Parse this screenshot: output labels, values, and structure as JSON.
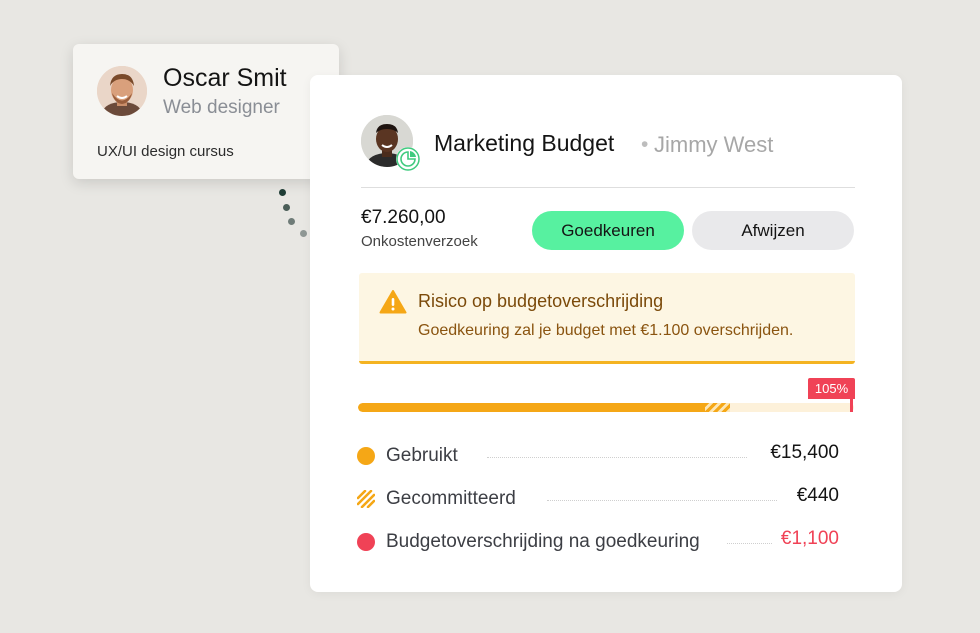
{
  "profile": {
    "name": "Oscar Smit",
    "role": "Web designer",
    "course": "UX/UI design cursus",
    "avatar_icon": "person-avatar"
  },
  "request": {
    "title": "Marketing Budget",
    "separator": "•",
    "owner": "Jimmy West",
    "avatar_icon": "person-avatar",
    "badge_icon": "pie-chart-icon",
    "amount": "€7.260,00",
    "amount_label": "Onkostenverzoek"
  },
  "actions": {
    "approve_label": "Goedkeuren",
    "reject_label": "Afwijzen"
  },
  "alert": {
    "icon": "warning-icon",
    "title": "Risico op budgetoverschrijding",
    "message": "Goedkeuring zal je budget met €1.100 overschrijden."
  },
  "progress": {
    "percent_label": "105%",
    "used_fraction": 0.7,
    "committed_fraction": 0.05
  },
  "legend": [
    {
      "label": "Gebruikt",
      "value": "€15,400",
      "marker": "dot",
      "color": "#f5a716",
      "value_color": "#141414"
    },
    {
      "label": "Gecommitteerd",
      "value": "€440",
      "marker": "stripes",
      "color": "#f5a716",
      "value_color": "#141414"
    },
    {
      "label": "Budgetoverschrijding na goedkeuring",
      "value": "€1,100",
      "marker": "dot",
      "color": "#f04256",
      "value_color": "#f04256"
    }
  ],
  "colors": {
    "accent_green": "#57f1a0",
    "warning_orange": "#f5a716",
    "danger_red": "#f04256",
    "background": "#e8e7e3"
  }
}
